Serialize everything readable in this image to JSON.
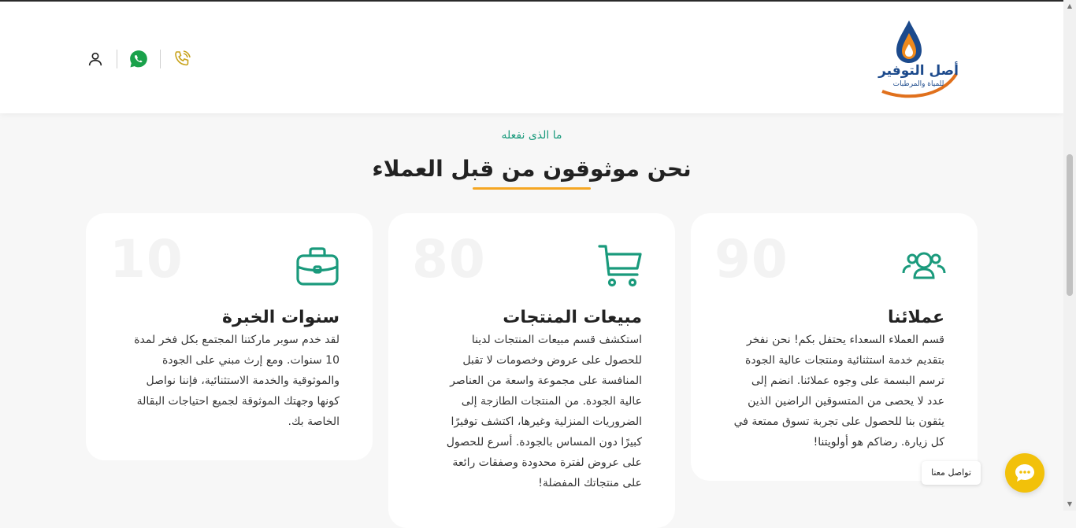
{
  "logo": {
    "title": "أصل التوفير",
    "subtitle": "للمياة والمرطبات"
  },
  "header": {
    "icons": [
      "phone-icon",
      "whatsapp-icon",
      "user-icon"
    ]
  },
  "section": {
    "eyebrow": "ما الذى نفعله",
    "title": "نحن موثوقون من قبل العملاء"
  },
  "cards": [
    {
      "number": "90",
      "icon": "users-icon",
      "title": "عملائنا",
      "body": [
        "قسم العملاء السعداء يحتفل بكم! نحن نفخر",
        "بتقديم خدمة استثنائية ومنتجات عالية الجودة",
        "ترسم البسمة على وجوه عملائنا. انضم إلى",
        "عدد لا يحصى من المتسوقين الراضين الذين",
        "يثقون بنا للحصول على تجربة تسوق ممتعة في",
        "كل زيارة. رضاكم هو أولويتنا!"
      ]
    },
    {
      "number": "80",
      "icon": "cart-icon",
      "title": "مبيعات المنتجات",
      "body": [
        "استكشف قسم مبيعات المنتجات لدينا",
        "للحصول على عروض وخصومات لا تقبل",
        "المنافسة على مجموعة واسعة من العناصر",
        "عالية الجودة. من المنتجات الطازجة إلى",
        "الضروريات المنزلية وغيرها، اكتشف توفيرًا",
        "كبيرًا دون المساس بالجودة. أسرع للحصول",
        "على عروض لفترة محدودة وصفقات رائعة",
        "على منتجاتك المفضلة!"
      ]
    },
    {
      "number": "10",
      "icon": "briefcase-icon",
      "title": "سنوات الخبرة",
      "body": [
        "لقد خدم سوبر ماركتنا المجتمع بكل فخر لمدة",
        "10 سنوات. ومع إرث مبني على الجودة",
        "والموثوقية والخدمة الاستثنائية، فإننا نواصل",
        "كونها وجهتك الموثوقة لجميع احتياجات البقالة",
        "الخاصة بك."
      ]
    }
  ],
  "chat": {
    "tooltip": "تواصل معنا",
    "icon": "chat-icon"
  },
  "colors": {
    "accent_green": "#1a9a7c",
    "accent_orange": "#f5a623",
    "chat_yellow": "#f2c10a",
    "phone_gold": "#c8a21a",
    "whatsapp_green": "#1aa14b"
  }
}
